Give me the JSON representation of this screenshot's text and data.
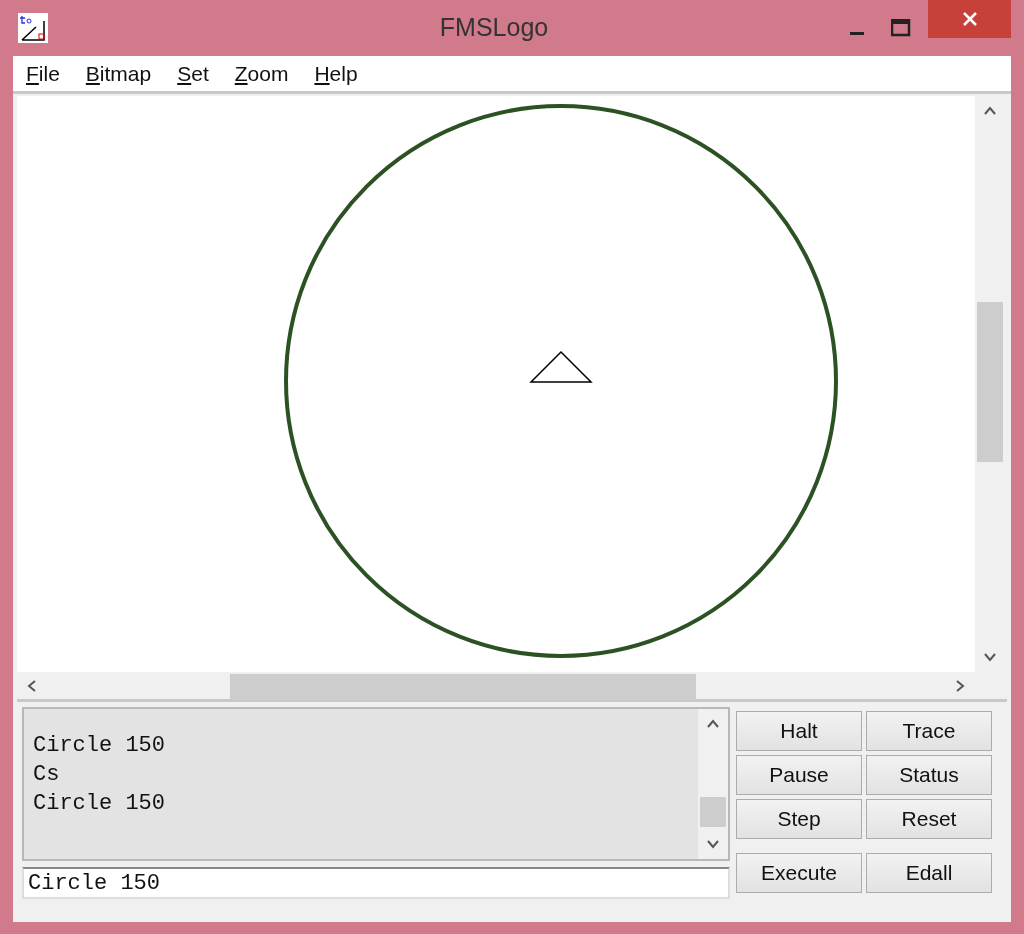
{
  "window": {
    "title": "FMSLogo"
  },
  "menu": [
    {
      "label": "File"
    },
    {
      "label": "Bitmap"
    },
    {
      "label": "Set"
    },
    {
      "label": "Zoom"
    },
    {
      "label": "Help"
    }
  ],
  "history": [
    "Circle 150",
    "Cs",
    "Circle 150"
  ],
  "command_input": {
    "value": "Circle 150"
  },
  "buttons": [
    [
      "Halt",
      "Trace"
    ],
    [
      "Pause",
      "Status"
    ],
    [
      "Step",
      "Reset"
    ]
  ],
  "action_buttons": [
    "Execute",
    "Edall"
  ]
}
